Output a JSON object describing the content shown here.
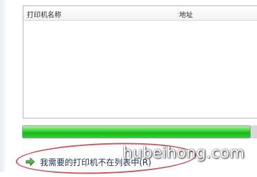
{
  "printer_list": {
    "columns": [
      "打印机名称",
      "地址"
    ],
    "rows": []
  },
  "progress": {
    "fraction": 1.0,
    "color": "#2cc22a"
  },
  "link": {
    "label": "我需要的打印机不在列表中(R)",
    "icon": "green-arrow-right-icon"
  },
  "watermark": {
    "text": "hubeihong.com"
  }
}
